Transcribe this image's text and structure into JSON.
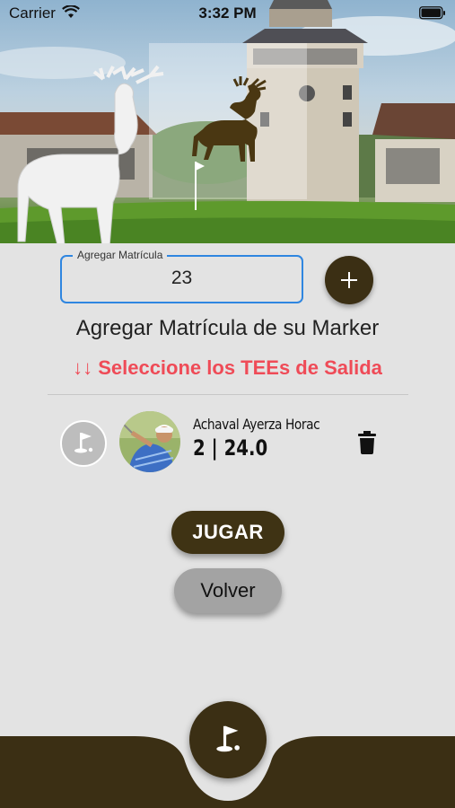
{
  "status_bar": {
    "carrier": "Carrier",
    "time": "3:32 PM"
  },
  "hero": {
    "image": "golf-club-house-with-deer-statues",
    "logo_icon": "deer-icon"
  },
  "marker_input": {
    "label": "Agregar Matrícula",
    "value": "23"
  },
  "add_button": {
    "icon": "plus-icon"
  },
  "title": "Agregar Matrícula de su Marker",
  "subtitle": "↓↓ Seleccione los TEEs de Salida",
  "player": {
    "tee_icon": "golf-flag-icon",
    "name": "Achaval Ayerza Horac",
    "stats": "2 | 24.0",
    "delete_icon": "trash-icon"
  },
  "buttons": {
    "play_label": "JUGAR",
    "back_label": "Volver"
  },
  "bottom_nav": {
    "home_icon": "golf-flag-icon"
  },
  "colors": {
    "brand_brown": "#3b2f14",
    "alert_red": "#ef4b57",
    "focus_blue": "#2f86e0",
    "background": "#e3e3e3"
  }
}
